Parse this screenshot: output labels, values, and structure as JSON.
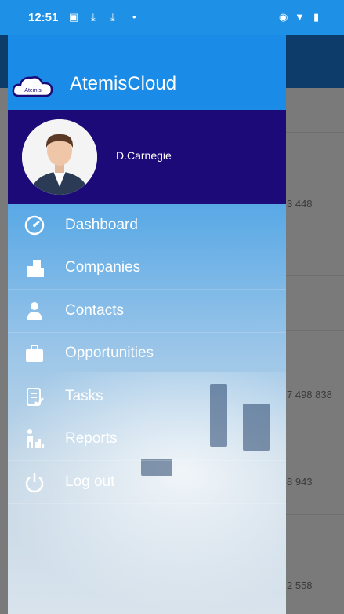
{
  "status": {
    "time": "12:51"
  },
  "app": {
    "title": "AtemisCloud",
    "logo_text": "Atemis"
  },
  "user": {
    "name": "D.Carnegie"
  },
  "menu": [
    {
      "label": "Dashboard",
      "icon": "dashboard-icon"
    },
    {
      "label": "Companies",
      "icon": "companies-icon"
    },
    {
      "label": "Contacts",
      "icon": "contacts-icon"
    },
    {
      "label": "Opportunities",
      "icon": "briefcase-icon"
    },
    {
      "label": "Tasks",
      "icon": "tasks-icon"
    },
    {
      "label": "Reports",
      "icon": "reports-icon"
    },
    {
      "label": "Log out",
      "icon": "power-icon"
    }
  ],
  "background_values": [
    "3 448",
    "7 498 838",
    "8 943",
    "2 558"
  ],
  "colors": {
    "status_bar": "#1e90e6",
    "drawer_header": "#1a8be6",
    "profile_band": "#1b0a78",
    "app_topbar": "#0e3c6a"
  }
}
